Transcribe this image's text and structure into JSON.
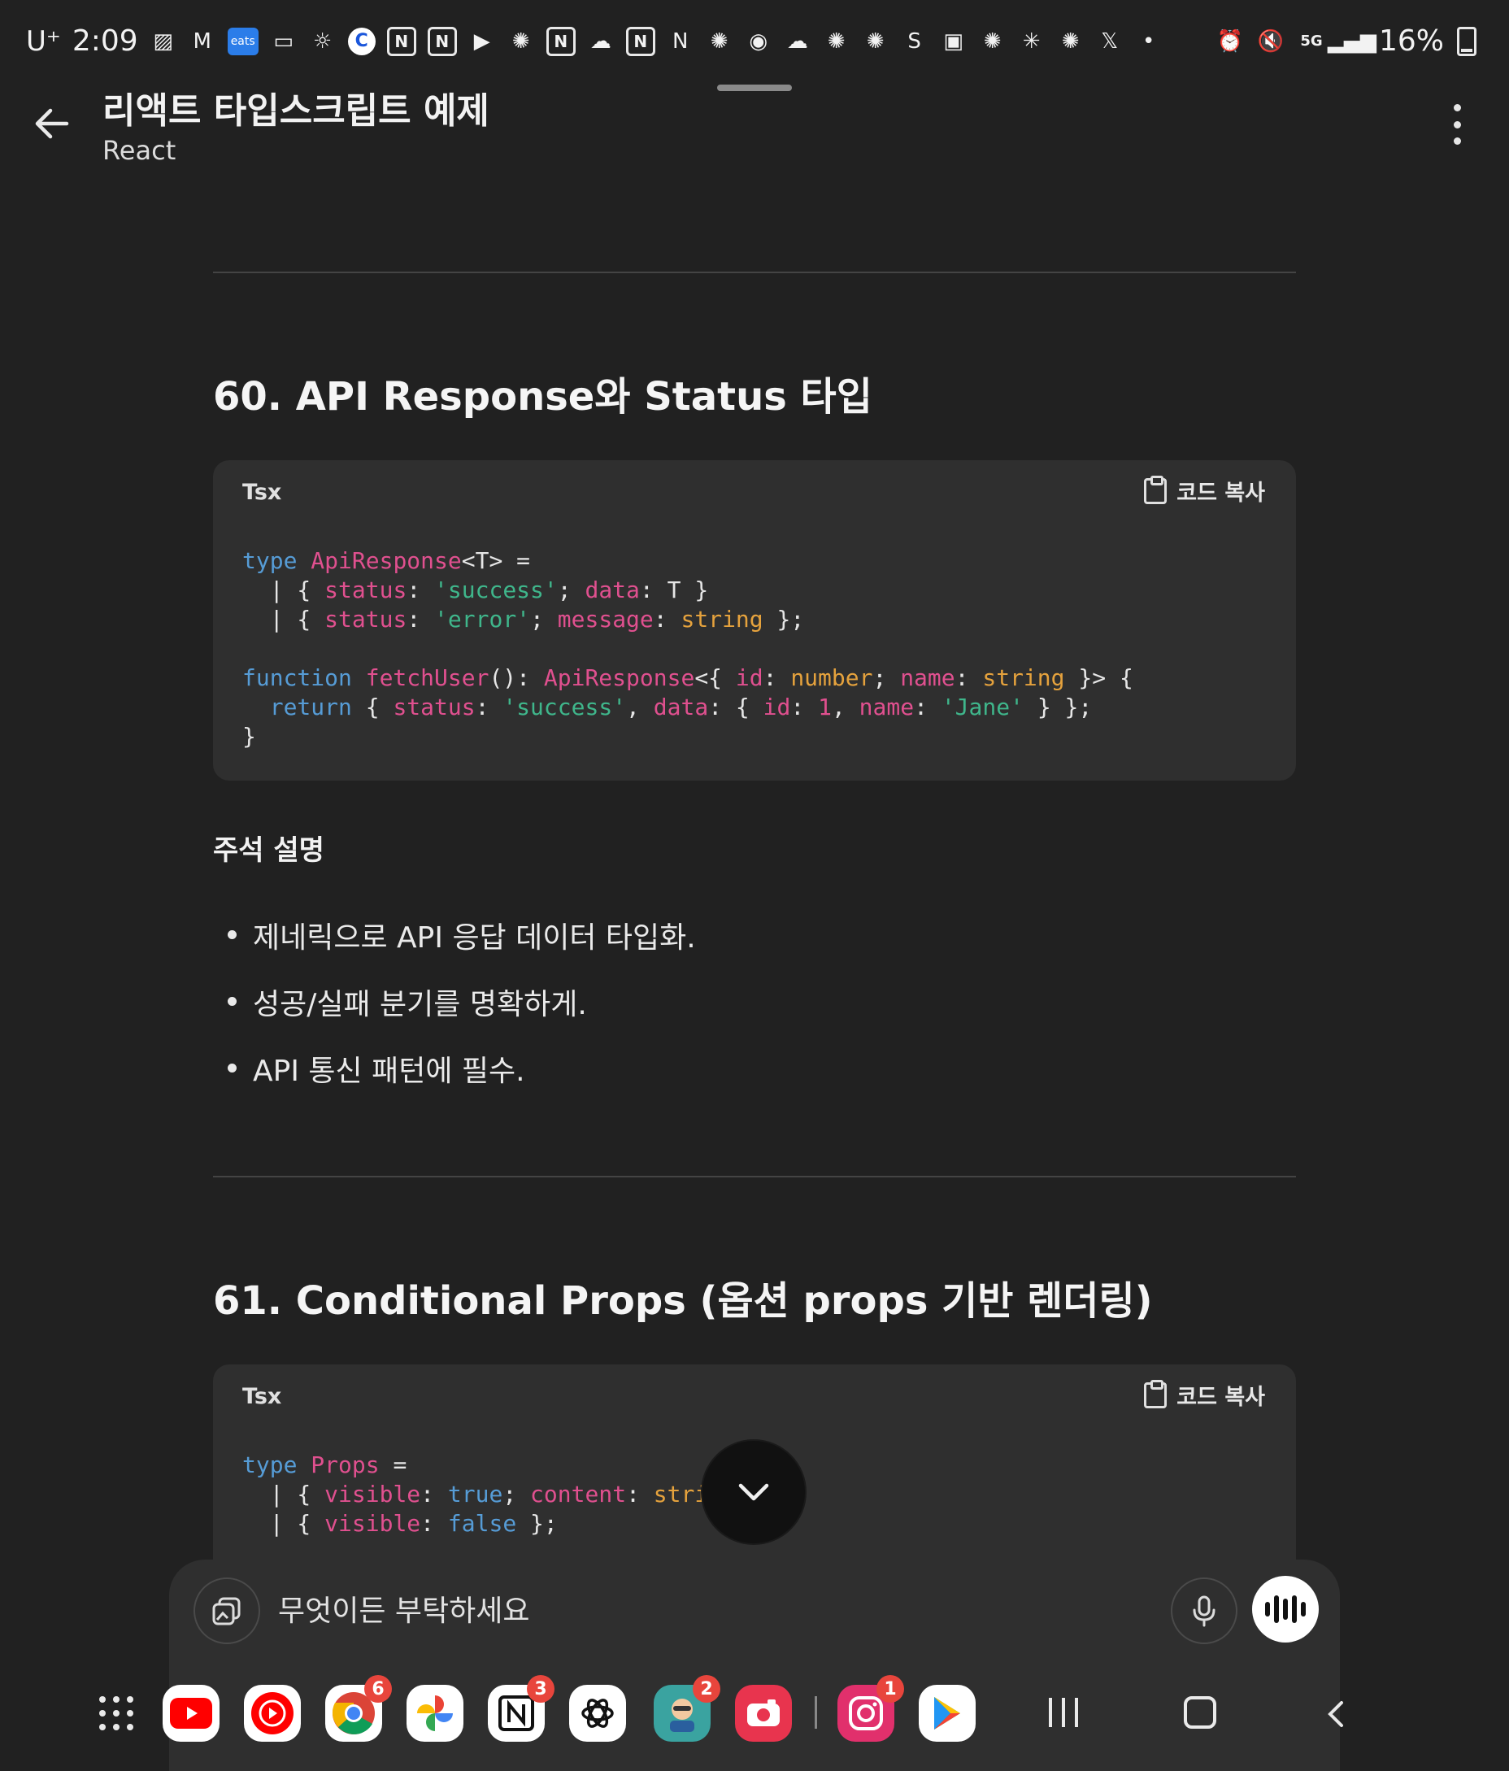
{
  "status_bar": {
    "carrier": "U⁺",
    "time": "2:09",
    "battery": "16%"
  },
  "header": {
    "title": "리액트 타입스크립트 예제",
    "subtitle": "React"
  },
  "sections": [
    {
      "title": "60. API Response와 Status 타입",
      "code_lang": "Tsx",
      "copy_label": "코드 복사"
    },
    {
      "title": "61. Conditional Props (옵션 props 기반 렌더링)",
      "code_lang": "Tsx",
      "copy_label": "코드 복사"
    }
  ],
  "notes": {
    "heading": "주석 설명",
    "bullets": [
      "제네릭으로 API 응답 데이터 타입화.",
      "성공/실패 분기를 명확하게.",
      "API 통신 패턴에 필수."
    ]
  },
  "composer": {
    "placeholder": "무엇이든 부탁하세요"
  },
  "taskbar": {
    "badges": {
      "chrome": "6",
      "notion": "3",
      "game": "2",
      "instagram": "1"
    },
    "colors": {
      "youtube": "#ff0000",
      "youtube_music": "#ff0000",
      "instagram": "#e1306c",
      "camera": "#e8344e"
    }
  }
}
